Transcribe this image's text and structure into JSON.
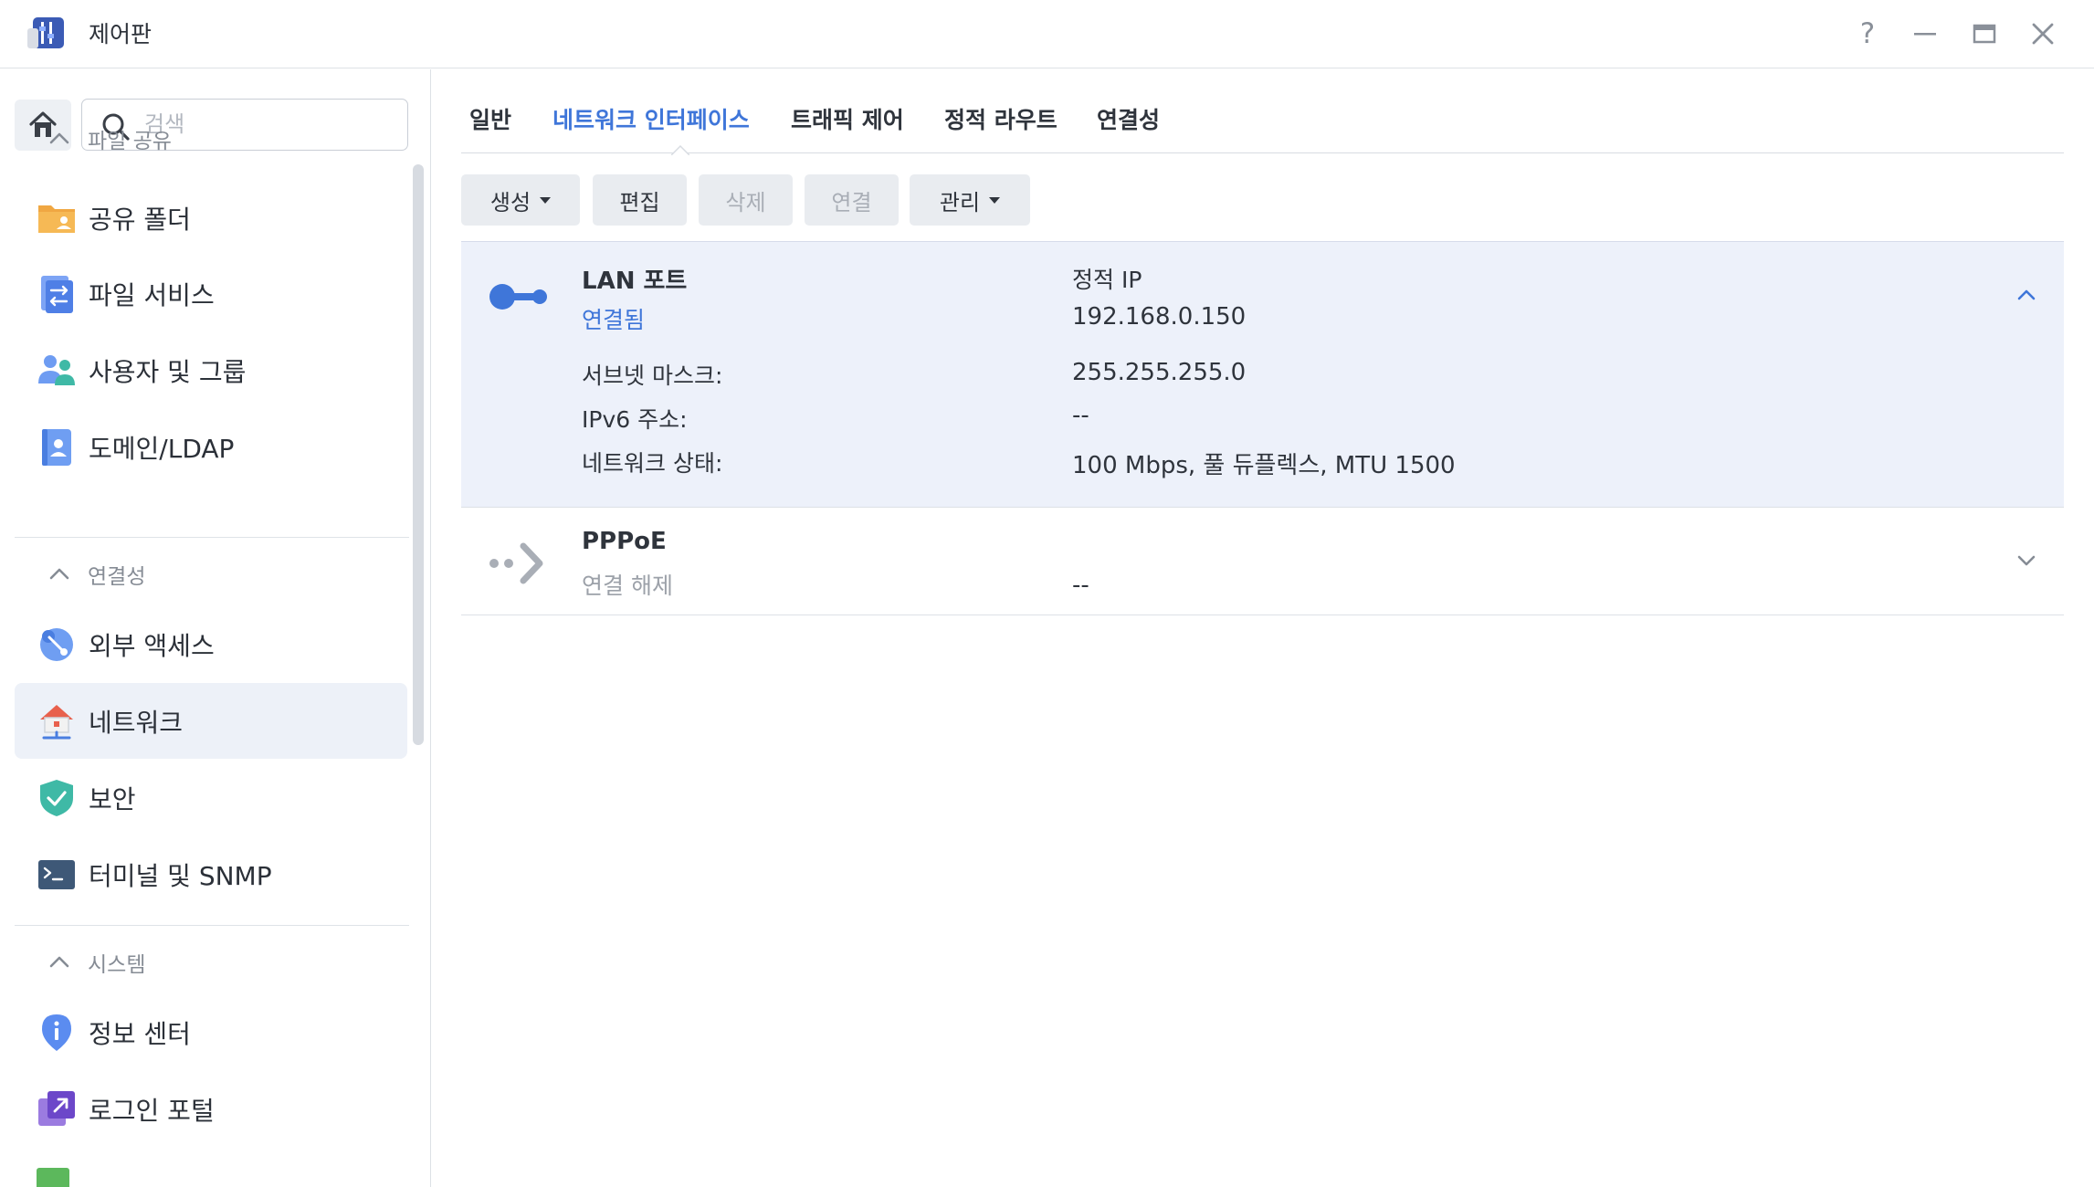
{
  "window": {
    "title": "제어판",
    "controls": {
      "help": "?"
    }
  },
  "sidebar": {
    "search": {
      "placeholder": "검색",
      "value": ""
    },
    "sections": [
      {
        "label": "파일 공유",
        "items": [
          {
            "label": "공유 폴더",
            "icon": "shared-folder-icon"
          },
          {
            "label": "파일 서비스",
            "icon": "file-services-icon"
          },
          {
            "label": "사용자 및 그룹",
            "icon": "user-group-icon"
          },
          {
            "label": "도메인/LDAP",
            "icon": "domain-ldap-icon"
          }
        ]
      },
      {
        "label": "연결성",
        "items": [
          {
            "label": "외부 액세스",
            "icon": "external-access-icon"
          },
          {
            "label": "네트워크",
            "icon": "network-icon",
            "active": true
          },
          {
            "label": "보안",
            "icon": "security-shield-icon"
          },
          {
            "label": "터미널 및 SNMP",
            "icon": "terminal-icon"
          }
        ]
      },
      {
        "label": "시스템",
        "items": [
          {
            "label": "정보 센터",
            "icon": "info-center-icon"
          },
          {
            "label": "로그인 포털",
            "icon": "login-portal-icon"
          }
        ]
      }
    ]
  },
  "tabs": [
    {
      "label": "일반"
    },
    {
      "label": "네트워크 인터페이스",
      "active": true
    },
    {
      "label": "트래픽 제어"
    },
    {
      "label": "정적 라우트"
    },
    {
      "label": "연결성"
    }
  ],
  "toolbar": {
    "create": "생성",
    "edit": "편집",
    "delete": "삭제",
    "connect": "연결",
    "manage": "관리"
  },
  "interfaces": [
    {
      "name": "LAN 포트",
      "status": "연결됨",
      "ip_type": "정적 IP",
      "ip": "192.168.0.150",
      "details": [
        {
          "label": "서브넷 마스크:",
          "value": "255.255.255.0"
        },
        {
          "label": "IPv6 주소:",
          "value": "--"
        },
        {
          "label": "네트워크 상태:",
          "value": "100 Mbps, 풀 듀플렉스, MTU 1500"
        }
      ],
      "expanded": true
    },
    {
      "name": "PPPoE",
      "status": "연결 해제",
      "ip": "--",
      "expanded": false
    }
  ],
  "colors": {
    "accent": "#3f76d9",
    "active_row": "#edf1fa",
    "disabled_text": "#a9aeb6"
  }
}
